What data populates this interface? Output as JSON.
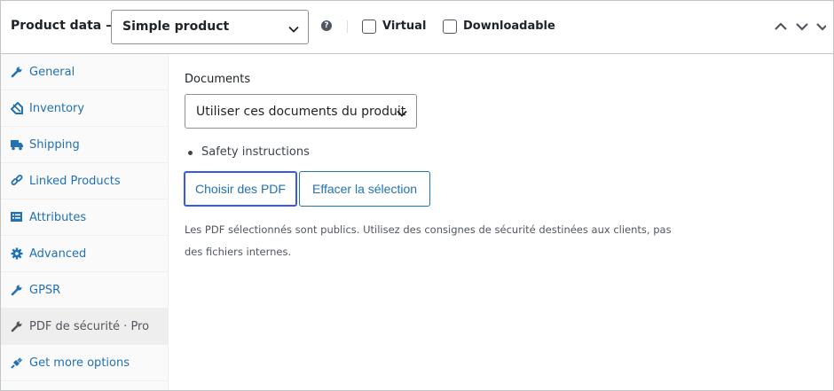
{
  "header": {
    "title": "Product data —",
    "product_type": "Simple product",
    "help_symbol": "?",
    "virtual_label": "Virtual",
    "downloadable_label": "Downloadable"
  },
  "tabs": [
    {
      "label": "General",
      "icon": "wrench-icon"
    },
    {
      "label": "Inventory",
      "icon": "tag-icon"
    },
    {
      "label": "Shipping",
      "icon": "truck-icon"
    },
    {
      "label": "Linked Products",
      "icon": "link-icon"
    },
    {
      "label": "Attributes",
      "icon": "list-icon"
    },
    {
      "label": "Advanced",
      "icon": "gear-icon"
    },
    {
      "label": "GPSR",
      "icon": "wrench-icon"
    },
    {
      "label": "PDF de sécurité · Pro",
      "icon": "wrench-icon",
      "active": true
    },
    {
      "label": "Get more options",
      "icon": "plugin-icon"
    }
  ],
  "main": {
    "documents_label": "Documents",
    "documents_select": "Utiliser ces documents du produit",
    "documents_list": [
      "Safety instructions"
    ],
    "choose_button": "Choisir des PDF",
    "clear_button": "Effacer la sélection",
    "note": "Les PDF sélectionnés sont publics. Utilisez des consignes de sécurité destinées aux clients, pas des fichiers internes."
  },
  "colors": {
    "link": "#2271b1",
    "focus": "#3858e9",
    "border": "#c3c4c7",
    "active_tab_bg": "#eeeeee",
    "sidebar_bg": "#fafafa"
  }
}
